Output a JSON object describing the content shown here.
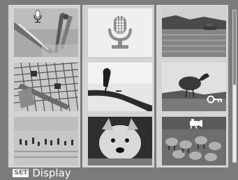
{
  "footer": {
    "button_key": "SET",
    "action_label": "Display"
  },
  "grid": {
    "columns": 3,
    "rows": 3,
    "selected_index": 1,
    "items": [
      {
        "subject": "pencils-and-compass",
        "badges": [
          "voice-memo-icon"
        ]
      },
      {
        "subject": "voice-memo-file",
        "badges": []
      },
      {
        "subject": "lake-with-boat",
        "badges": []
      },
      {
        "subject": "crossword-and-pencil",
        "badges": []
      },
      {
        "subject": "bird-on-branch",
        "badges": []
      },
      {
        "subject": "heron-by-water",
        "badges": [
          "protect-key-icon"
        ]
      },
      {
        "subject": "flamingos-in-water",
        "badges": []
      },
      {
        "subject": "dog-portrait",
        "badges": []
      },
      {
        "subject": "sheep-flock",
        "badges": [
          "movie-camera-icon"
        ]
      }
    ]
  },
  "scrollbar": {
    "position_fraction": 0.0,
    "visible_fraction": 0.49
  }
}
